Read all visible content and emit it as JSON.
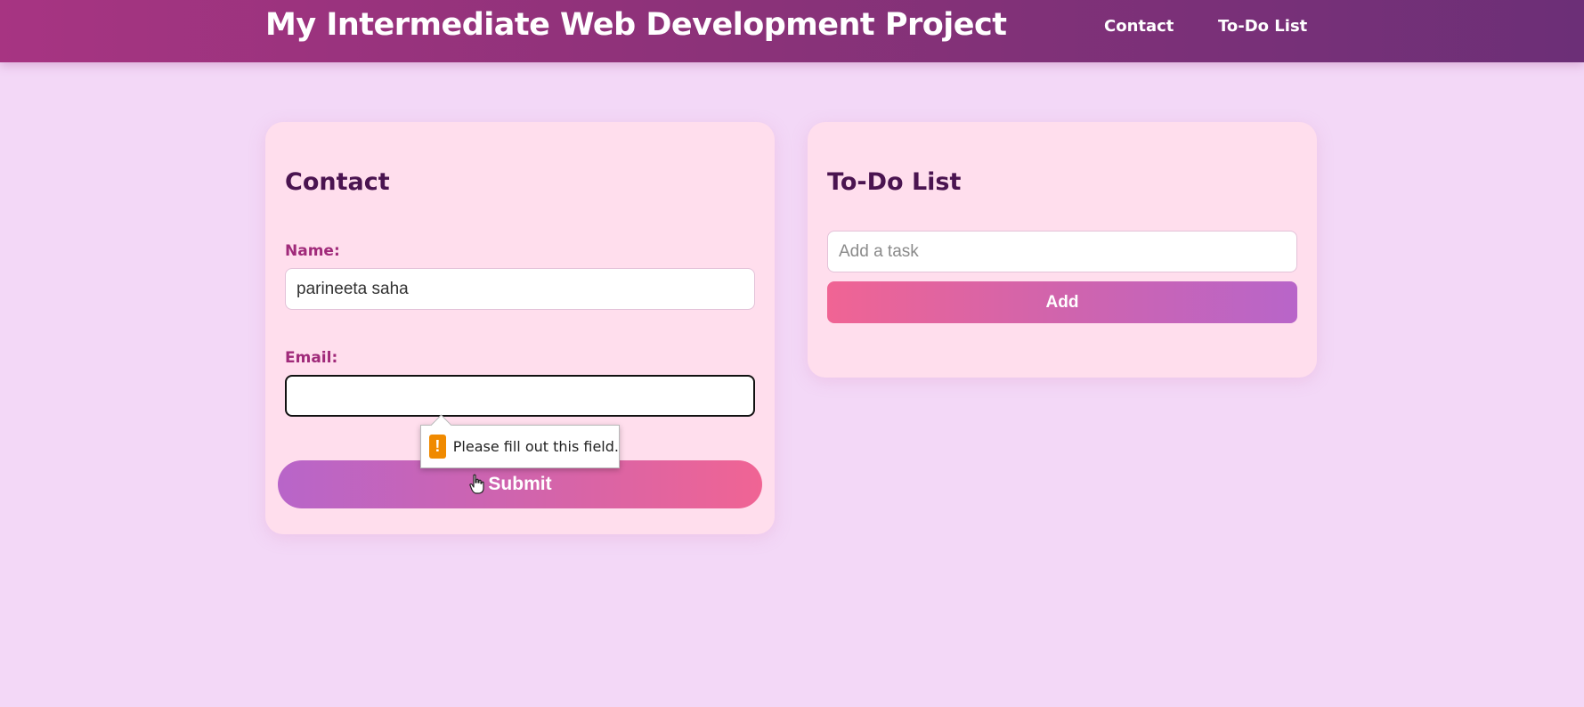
{
  "header": {
    "title": "My Intermediate Web Development Project",
    "nav": [
      "Contact",
      "To-Do List"
    ]
  },
  "contact": {
    "heading": "Contact",
    "name_label": "Name:",
    "name_value": "parineeta saha",
    "email_label": "Email:",
    "email_value": "",
    "submit_label": "Submit",
    "validation_message": "Please fill out this field."
  },
  "todo": {
    "heading": "To-Do List",
    "task_placeholder": "Add a task",
    "add_label": "Add"
  },
  "colors": {
    "background": "#f3d8f7",
    "header_gradient_start": "#a73482",
    "header_gradient_end": "#6c2f77",
    "card": "#ffdeed",
    "label": "#a02a7a",
    "heading": "#4a1450",
    "button_pink": "#f06494",
    "button_purple": "#b865c9",
    "warning": "#f08a00"
  },
  "icons": [
    "warning-icon",
    "hand-pointer-icon"
  ]
}
